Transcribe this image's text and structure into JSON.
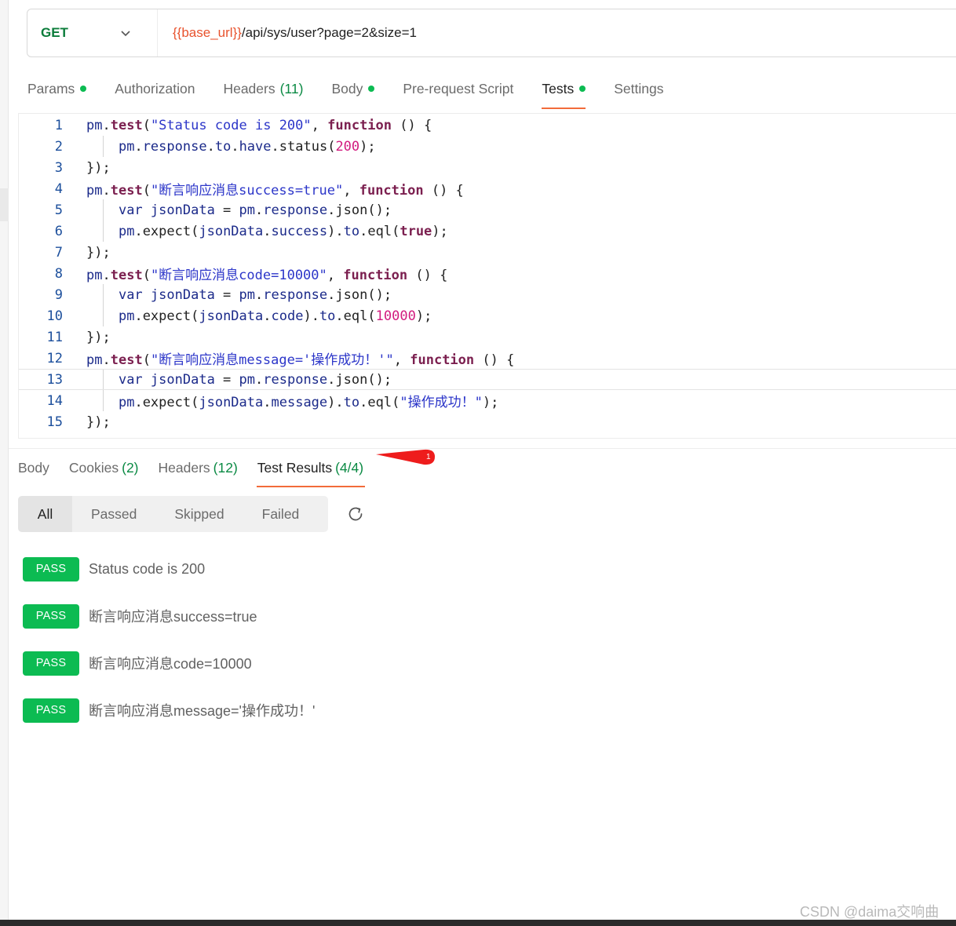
{
  "request": {
    "method": "GET",
    "url_variable": "{{base_url}}",
    "url_path": "/api/sys/user?page=2&size=1"
  },
  "request_tabs": [
    {
      "label": "Params",
      "count": "",
      "dot": true
    },
    {
      "label": "Authorization",
      "count": "",
      "dot": false
    },
    {
      "label": "Headers",
      "count": "(11)",
      "dot": false
    },
    {
      "label": "Body",
      "count": "",
      "dot": true
    },
    {
      "label": "Pre-request Script",
      "count": "",
      "dot": false
    },
    {
      "label": "Tests",
      "count": "",
      "dot": true,
      "active": true
    },
    {
      "label": "Settings",
      "count": "",
      "dot": false
    }
  ],
  "editor": {
    "lines": [
      {
        "n": "1"
      },
      {
        "n": "2"
      },
      {
        "n": "3"
      },
      {
        "n": "4"
      },
      {
        "n": "5"
      },
      {
        "n": "6"
      },
      {
        "n": "7"
      },
      {
        "n": "8"
      },
      {
        "n": "9"
      },
      {
        "n": "10"
      },
      {
        "n": "11"
      },
      {
        "n": "12"
      },
      {
        "n": "13"
      },
      {
        "n": "14"
      },
      {
        "n": "15"
      }
    ],
    "tokens": {
      "pm": "pm",
      "test": "test",
      "function": "function",
      "var": "var",
      "jsonData": "jsonData",
      "response": "response",
      "to": "to",
      "have": "have",
      "status": "status",
      "json": "json",
      "expect": "expect",
      "eql": "eql",
      "success": "success",
      "code": "code",
      "message": "message",
      "true": "true",
      "s1": "\"Status code is 200\"",
      "s2": "\"断言响应消息success=true\"",
      "s3": "\"断言响应消息code=10000\"",
      "s4": "\"断言响应消息message='操作成功！'\"",
      "s5": "\"操作成功！\"",
      "n200": "200",
      "n10000": "10000"
    },
    "current_line": 13
  },
  "response_tabs": [
    {
      "label": "Body",
      "count": ""
    },
    {
      "label": "Cookies",
      "count": "(2)"
    },
    {
      "label": "Headers",
      "count": "(12)"
    },
    {
      "label": "Test Results",
      "count": "(4/4)",
      "active": true
    }
  ],
  "annotation_marker": "1",
  "filters": [
    "All",
    "Passed",
    "Skipped",
    "Failed"
  ],
  "results": [
    {
      "status": "PASS",
      "name": "Status code is 200"
    },
    {
      "status": "PASS",
      "name": "断言响应消息success=true"
    },
    {
      "status": "PASS",
      "name": "断言响应消息code=10000"
    },
    {
      "status": "PASS",
      "name": "断言响应消息message='操作成功！'"
    }
  ],
  "watermark": "CSDN @daima交响曲",
  "colors": {
    "accent": "#f26b3a",
    "pass": "#0cbb52",
    "method_get": "#0b7c3a",
    "url_variable": "#e8532e"
  }
}
